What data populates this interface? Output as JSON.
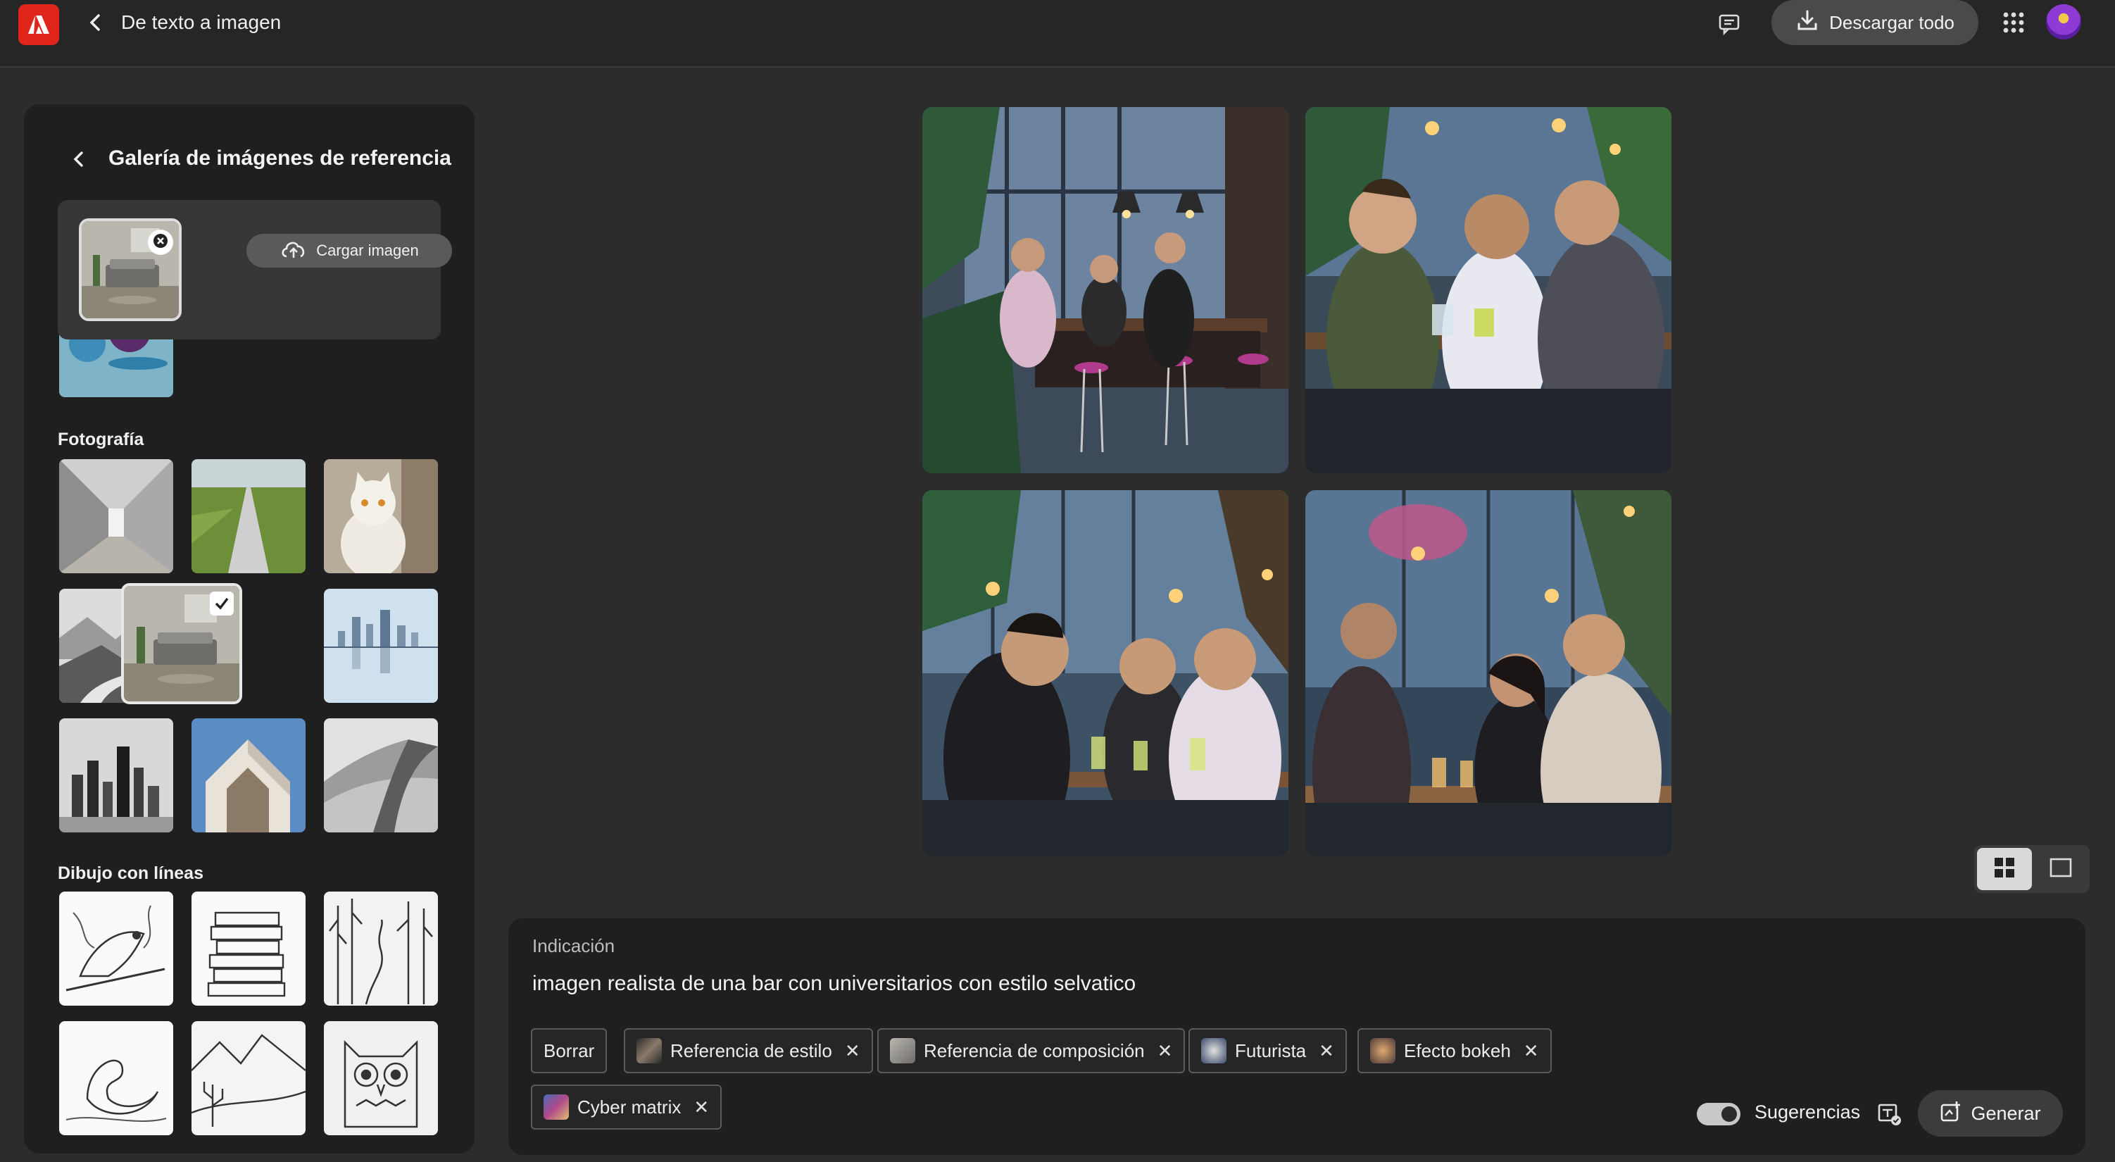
{
  "topbar": {
    "app_icon": "adobe-logo-icon",
    "back_icon": "chevron-left-icon",
    "title": "De texto a imagen",
    "feedback_icon": "comment-icon",
    "download_all_label": "Descargar todo",
    "download_icon": "download-icon",
    "apps_icon": "app-grid-icon",
    "avatar_icon": "user-avatar"
  },
  "sidebar": {
    "title": "Galería de imágenes de referencia",
    "back_icon": "chevron-left-icon",
    "upload_label": "Cargar imagen",
    "upload_icon": "cloud-upload-icon",
    "sections": [
      {
        "label": "Fotografía",
        "items": [
          "corridor",
          "road-field",
          "cat",
          "misty-mountains",
          "living-room",
          "city-skyline",
          "bw-skyline",
          "modern-building",
          "sand-dunes"
        ],
        "selected_index": 4
      },
      {
        "label": "Dibujo con líneas",
        "items": [
          "bird-sketch",
          "books-sketch",
          "forest-sketch",
          "swan-sketch",
          "desert-sketch",
          "owl-sketch"
        ]
      }
    ]
  },
  "gallery": {
    "images": [
      "bar-image-1",
      "bar-image-2",
      "bar-image-3",
      "bar-image-4"
    ],
    "view_grid_icon": "grid-view-icon",
    "view_single_icon": "single-view-icon"
  },
  "prompt": {
    "label": "Indicación",
    "text": "imagen realista de una bar con universitarios con estilo selvatico",
    "clear_label": "Borrar",
    "chips": [
      {
        "label": "Referencia de estilo"
      },
      {
        "label": "Referencia de composición"
      },
      {
        "label": "Futurista"
      },
      {
        "label": "Efecto bokeh"
      },
      {
        "label": "Cyber matrix"
      }
    ],
    "suggestions_label": "Sugerencias",
    "suggestions_enabled": true,
    "generate_label": "Generar",
    "generate_icon": "generate-icon",
    "content_credentials_icon": "content-credentials-icon"
  },
  "colors": {
    "background": "#2c2c2c",
    "panel": "#1f1f1f",
    "adobe_red": "#e0261b"
  }
}
